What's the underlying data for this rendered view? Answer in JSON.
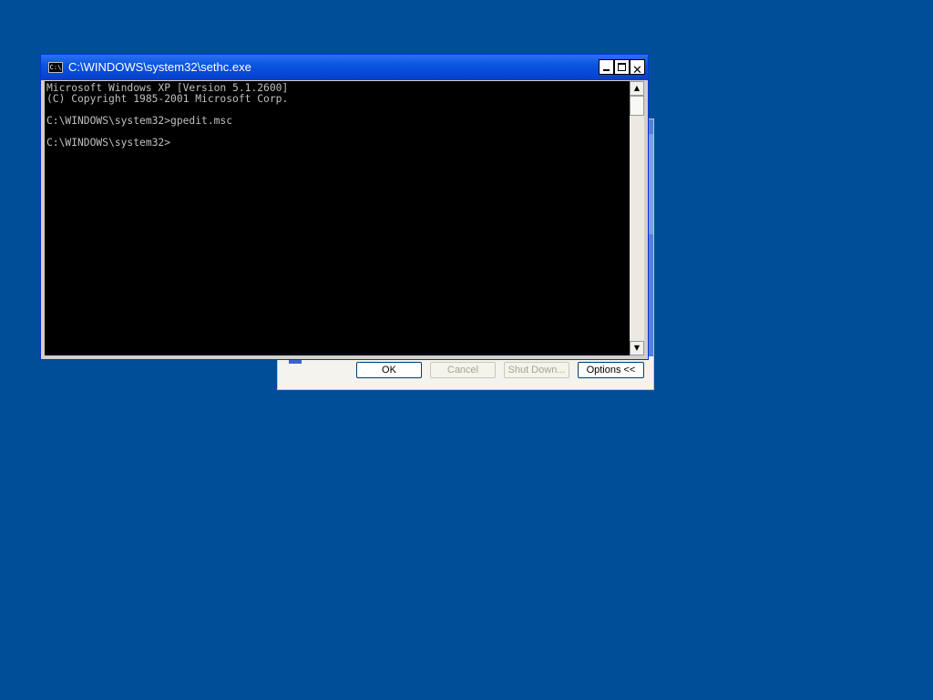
{
  "dialog": {
    "buttons": {
      "ok": "OK",
      "cancel": "Cancel",
      "shutdown": "Shut Down...",
      "options": "Options <<"
    }
  },
  "console": {
    "title": "C:\\WINDOWS\\system32\\sethc.exe",
    "icon_text": "C:\\",
    "output": "Microsoft Windows XP [Version 5.1.2600]\n(C) Copyright 1985-2001 Microsoft Corp.\n\nC:\\WINDOWS\\system32>gpedit.msc\n\nC:\\WINDOWS\\system32>",
    "titlebar_buttons": {
      "close": "✕"
    },
    "scrollbar": {
      "up_arrow": "▲",
      "down_arrow": "▼"
    }
  },
  "colors": {
    "desktop": "#004e98",
    "titlebar": "#0a55e0",
    "console_bg": "#000000",
    "console_fg": "#c0c0c0"
  }
}
